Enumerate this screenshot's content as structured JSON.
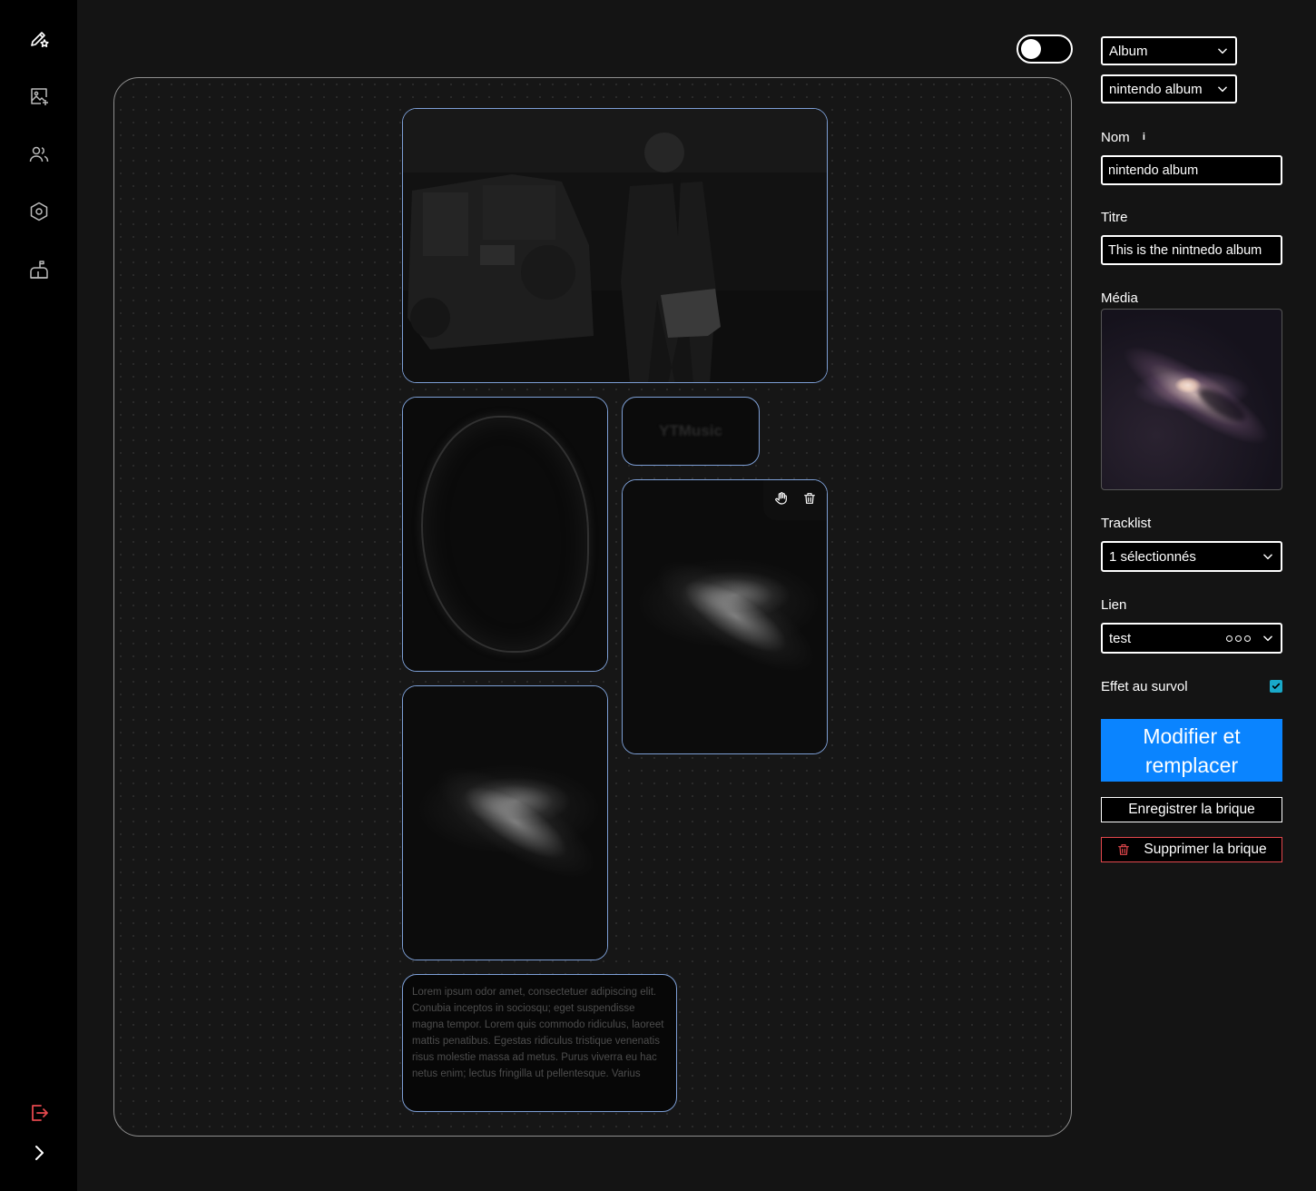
{
  "sidebar": {
    "items": [
      {
        "icon": "edit-star-icon",
        "name": "sidebar-item-editor"
      },
      {
        "icon": "image-add-icon",
        "name": "sidebar-item-media"
      },
      {
        "icon": "users-icon",
        "name": "sidebar-item-users"
      },
      {
        "icon": "hexagon-settings-icon",
        "name": "sidebar-item-settings"
      },
      {
        "icon": "mailbox-icon",
        "name": "sidebar-item-mailbox"
      }
    ],
    "logout_icon": "logout-icon",
    "expand_icon": "chevron-right-icon"
  },
  "canvas": {
    "toggle_on": false,
    "bricks": {
      "ytmusic_label": "YTMusic",
      "lorem_text": "Lorem ipsum odor amet, consectetuer adipiscing elit. Conubia inceptos in sociosqu; eget suspendisse magna tempor. Lorem quis commodo ridiculus, laoreet mattis penatibus. Egestas ridiculus tristique venenatis risus molestie massa ad metus. Purus viverra eu hac netus enim; lectus fringilla ut pellentesque. Varius"
    }
  },
  "panel": {
    "type_select": "Album",
    "album_select": "nintendo album",
    "nom_label": "Nom",
    "nom_info": "i",
    "nom_value": "nintendo album",
    "titre_label": "Titre",
    "titre_value": "This is the nintnedo album",
    "media_label": "Média",
    "tracklist_label": "Tracklist",
    "tracklist_value": "1 sélectionnés",
    "lien_label": "Lien",
    "lien_value": "test",
    "hover_label": "Effet au survol",
    "hover_checked": true,
    "primary_button": "Modifier et remplacer",
    "save_button": "Enregistrer la brique",
    "delete_button": "Supprimer la brique"
  },
  "colors": {
    "accent": "#0a84ff",
    "checkbox": "#19a9c9",
    "danger": "#e5484d",
    "brick_border": "#7d9fd6"
  }
}
